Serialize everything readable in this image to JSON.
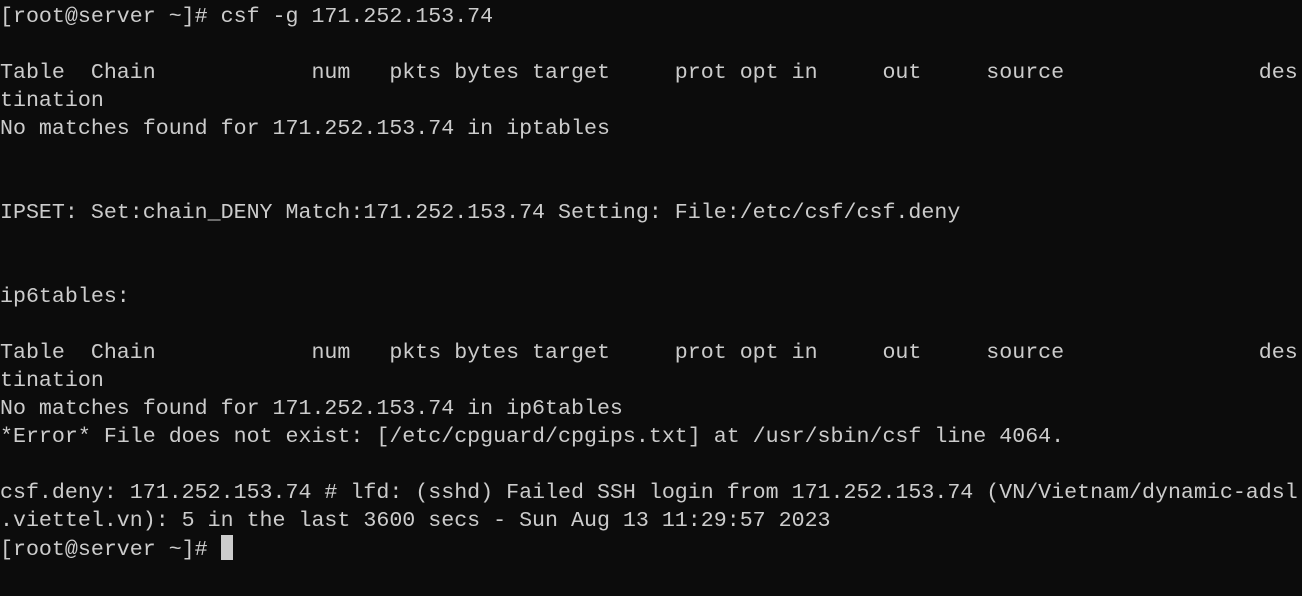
{
  "terminal": {
    "colors": {
      "background": "#0c0c0c",
      "foreground": "#cccccc"
    },
    "lines": [
      "[root@server ~]# csf -g 171.252.153.74",
      "",
      "Table  Chain            num   pkts bytes target     prot opt in     out     source               des",
      "tination",
      "No matches found for 171.252.153.74 in iptables",
      "",
      "",
      "IPSET: Set:chain_DENY Match:171.252.153.74 Setting: File:/etc/csf/csf.deny",
      "",
      "",
      "ip6tables:",
      "",
      "Table  Chain            num   pkts bytes target     prot opt in     out     source               des",
      "tination",
      "No matches found for 171.252.153.74 in ip6tables",
      "*Error* File does not exist: [/etc/cpguard/cpgips.txt] at /usr/sbin/csf line 4064.",
      "",
      "csf.deny: 171.252.153.74 # lfd: (sshd) Failed SSH login from 171.252.153.74 (VN/Vietnam/dynamic-adsl",
      ".viettel.vn): 5 in the last 3600 secs - Sun Aug 13 11:29:57 2023"
    ],
    "prompt": "[root@server ~]# "
  }
}
